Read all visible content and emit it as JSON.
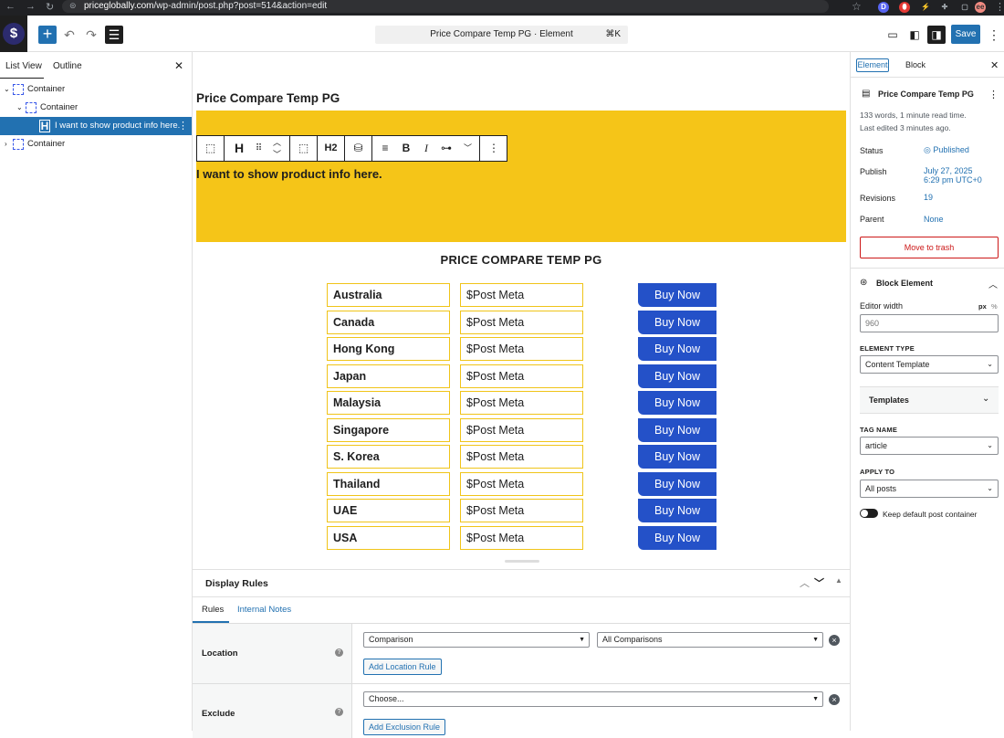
{
  "browser": {
    "url_host": "priceglobally.com",
    "url_path": "/wp-admin/post.php?post=514&action=edit"
  },
  "header": {
    "command_bar": "Price Compare Temp PG · Element",
    "command_shortcut": "⌘K",
    "save_label": "Save"
  },
  "left_panel": {
    "tabs": [
      "List View",
      "Outline"
    ],
    "tree": [
      {
        "label": "Container",
        "level": 0
      },
      {
        "label": "Container",
        "level": 1
      },
      {
        "label": "I want to show product info here.",
        "level": 2
      },
      {
        "label": "Container",
        "level": 0
      }
    ]
  },
  "canvas": {
    "post_title": "Price Compare Temp PG",
    "toolbar_heading_level": "H2",
    "heading_text": "I want to show product info here.",
    "content_title": "PRICE COMPARE TEMP PG",
    "rows": [
      {
        "country": "Australia",
        "price": "$Post Meta",
        "button": "Buy Now"
      },
      {
        "country": "Canada",
        "price": "$Post Meta",
        "button": "Buy Now"
      },
      {
        "country": "Hong Kong",
        "price": "$Post Meta",
        "button": "Buy Now"
      },
      {
        "country": "Japan",
        "price": "$Post Meta",
        "button": "Buy Now"
      },
      {
        "country": "Malaysia",
        "price": "$Post Meta",
        "button": "Buy Now"
      },
      {
        "country": "Singapore",
        "price": "$Post Meta",
        "button": "Buy Now"
      },
      {
        "country": "S. Korea",
        "price": "$Post Meta",
        "button": "Buy Now"
      },
      {
        "country": "Thailand",
        "price": "$Post Meta",
        "button": "Buy Now"
      },
      {
        "country": "UAE",
        "price": "$Post Meta",
        "button": "Buy Now"
      },
      {
        "country": "USA",
        "price": "$Post Meta",
        "button": "Buy Now"
      }
    ]
  },
  "display_rules": {
    "title": "Display Rules",
    "tabs": [
      "Rules",
      "Internal Notes"
    ],
    "location": {
      "label": "Location",
      "select1": "Comparison",
      "select2": "All Comparisons",
      "add_button": "Add Location Rule"
    },
    "exclude": {
      "label": "Exclude",
      "select1": "Choose...",
      "add_button": "Add Exclusion Rule"
    }
  },
  "right_panel": {
    "tabs": [
      "Element",
      "Block"
    ],
    "doc_title": "Price Compare Temp PG",
    "words": "133 words, 1 minute read time.",
    "last_edited": "Last edited 3 minutes ago.",
    "status_label": "Status",
    "status_value": "Published",
    "publish_label": "Publish",
    "publish_date": "July 27, 2025",
    "publish_time": "6:29 pm UTC+0",
    "revisions_label": "Revisions",
    "revisions_value": "19",
    "parent_label": "Parent",
    "parent_value": "None",
    "trash_label": "Move to trash",
    "block_section": "Block Element",
    "editor_width_label": "Editor width",
    "unit_px": "px",
    "unit_pct": "%",
    "editor_width_value": "960",
    "element_type_label": "ELEMENT TYPE",
    "element_type_value": "Content Template",
    "templates_label": "Templates",
    "tag_name_label": "TAG NAME",
    "tag_name_value": "article",
    "apply_to_label": "APPLY TO",
    "apply_to_value": "All posts",
    "keep_default_label": "Keep default post container"
  },
  "colors": {
    "accent": "#2271b1",
    "banner_yellow": "#f5c518",
    "buy_button": "#2451c8",
    "trash_red": "#cc1818"
  }
}
